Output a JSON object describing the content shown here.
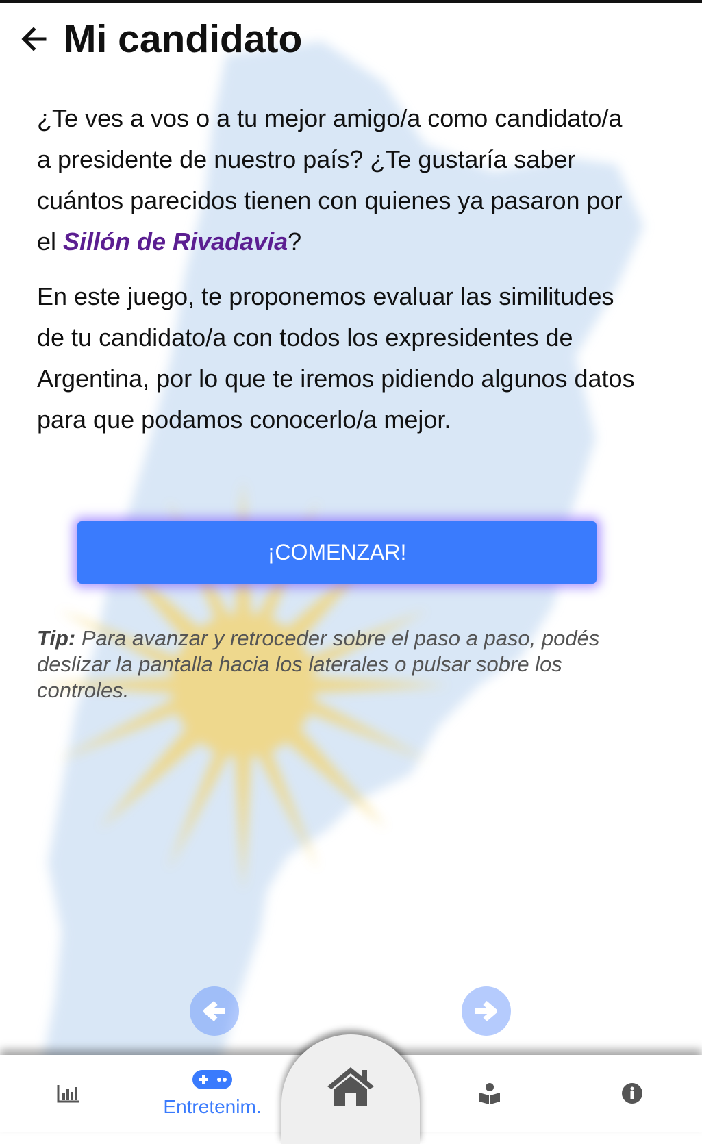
{
  "header": {
    "back_icon": "arrow-left-icon",
    "title": "Mi candidato"
  },
  "intro": {
    "p1_before": "¿Te ves a vos o a tu mejor amigo/a como candidato/a a presidente de nuestro país? ¿Te gustaría saber cuántos parecidos tienen con quienes ya pasaron por el ",
    "p1_highlight": "Sillón de Rivadavia",
    "p1_after": "?",
    "p2": "En este juego, te proponemos evaluar las similitudes de tu candidato/a con todos los expresidentes de Argentina, por lo que te iremos pidiendo algunos datos para que podamos conocerlo/a mejor."
  },
  "start_button": {
    "label": "¡COMENZAR!"
  },
  "tip": {
    "label": "Tip:",
    "text": " Para avanzar y retroceder sobre el paso a paso, podés deslizar la pantalla hacia los laterales o pulsar sobre los controles."
  },
  "step_nav": {
    "prev_icon": "arrow-circle-left-icon",
    "next_icon": "arrow-circle-right-icon"
  },
  "bottom_nav": {
    "stats_icon": "bar-chart-icon",
    "games_icon": "gamepad-icon",
    "games_label": "Entretenim.",
    "home_icon": "home-icon",
    "book_icon": "reader-book-icon",
    "info_icon": "info-icon"
  },
  "colors": {
    "accent": "#3a7bfd",
    "highlight": "#5b1e91",
    "sun": "#f5d36a",
    "map": "#c9ddf3"
  }
}
